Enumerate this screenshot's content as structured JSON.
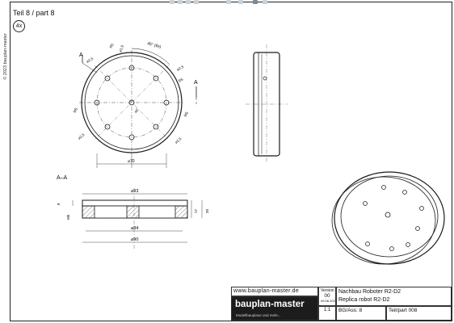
{
  "drawing": {
    "part_title": "Teil 8 / part 8",
    "quantity": "4x",
    "copyright": "© 2023 bauplan-master",
    "section_label": "A–A",
    "section_marker": "A"
  },
  "front_view": {
    "dims": {
      "pitch": "45° (8x)",
      "hole_left": "⌀2,5",
      "hole_top": "⌀1,5",
      "hole_right_top": "⌀2,5",
      "hole_left_bottom": "⌀2,5",
      "hole_right_bottom": "⌀1,5",
      "r_outer": "R5",
      "r_inner_top": "R5",
      "r_left": "M5",
      "r_right": "M5",
      "center": "⌀2",
      "bottom": "⌀70"
    }
  },
  "section_view": {
    "dims": {
      "top": "⌀93",
      "mid": "⌀84",
      "bottom": "⌀90",
      "h1": "8",
      "h2": "M5",
      "h3": "17",
      "h4": "20"
    }
  },
  "title_block": {
    "website": "www.bauplan-master.de",
    "brand": "bauplan-master",
    "tagline": "Modellbauplane und mehr...",
    "version_label": "Version",
    "version": "00",
    "date": "09.06.2023",
    "name_de": "Nachbau Roboter R2-D2",
    "name_en": "Replica robot R2-D2",
    "scale": "1:1",
    "assembly": "BG/Ass: 8",
    "part": "Teil/part 008"
  },
  "colors": {
    "line": "#1a1a1a",
    "hatch": "#333333",
    "logo_bg": "#1c1c1c"
  }
}
